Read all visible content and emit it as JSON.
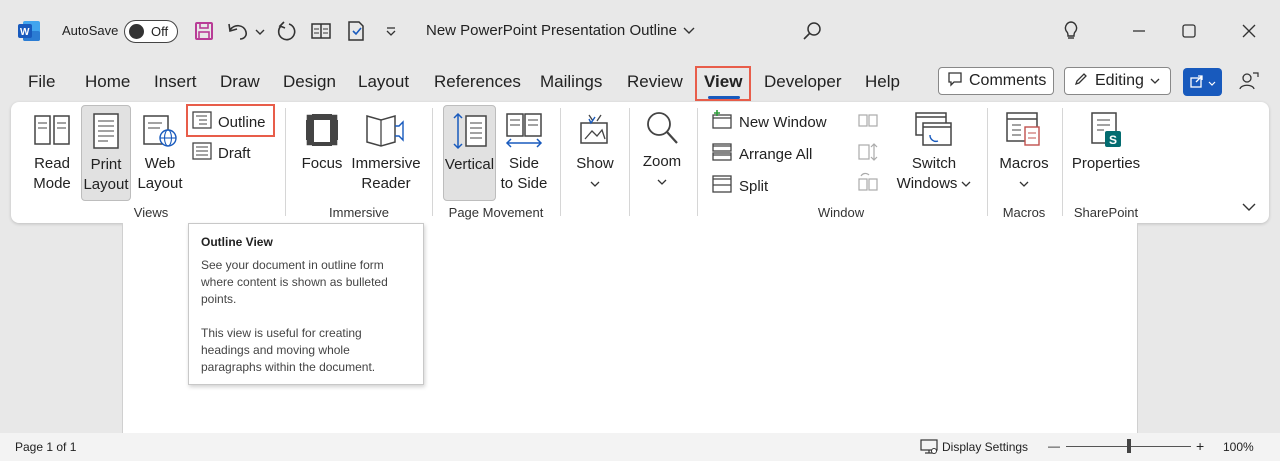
{
  "app": {
    "name": "Word"
  },
  "title_bar": {
    "autosave_label": "AutoSave",
    "autosave_state": "Off",
    "document_title": "New PowerPoint Presentation Outline",
    "icons": [
      "word-logo-icon",
      "save-icon",
      "undo-icon",
      "redo-icon",
      "table-icon",
      "document-check-icon",
      "customize-dropdown-icon",
      "search-icon",
      "lightbulb-icon",
      "minimize-icon",
      "maximize-icon",
      "close-icon"
    ]
  },
  "menu_tabs": [
    "File",
    "Home",
    "Insert",
    "Draw",
    "Design",
    "Layout",
    "References",
    "Mailings",
    "Review",
    "View",
    "Developer",
    "Help"
  ],
  "active_tab": "View",
  "header_buttons": {
    "comments": "Comments",
    "editing": "Editing"
  },
  "ribbon": {
    "views": {
      "label": "Views",
      "read_mode": [
        "Read",
        "Mode"
      ],
      "print_layout": [
        "Print",
        "Layout"
      ],
      "web_layout": [
        "Web",
        "Layout"
      ],
      "outline": "Outline",
      "draft": "Draft"
    },
    "immersive": {
      "label": "Immersive",
      "focus": "Focus",
      "immersive_reader": [
        "Immersive",
        "Reader"
      ]
    },
    "page_movement": {
      "label": "Page Movement",
      "vertical": "Vertical",
      "side_to_side": [
        "Side",
        "to Side"
      ]
    },
    "show": "Show",
    "zoom": "Zoom",
    "window": {
      "label": "Window",
      "new_window": "New Window",
      "arrange_all": "Arrange All",
      "split": "Split",
      "switch_windows": [
        "Switch",
        "Windows"
      ]
    },
    "macros": {
      "label": "Macros",
      "button": "Macros"
    },
    "sharepoint": {
      "label": "SharePoint",
      "properties": "Properties"
    }
  },
  "tooltip": {
    "title": "Outline View",
    "paragraph1": "See your document in outline form where content is shown as bulleted points.",
    "paragraph2": "This view is useful for creating headings and moving whole paragraphs within the document."
  },
  "status_bar": {
    "page": "Page 1 of 1",
    "display_settings": "Display Settings",
    "zoom_minus": "—",
    "zoom_plus": "+",
    "zoom": "100%",
    "zoom_slider_fraction": 0.5
  },
  "colors": {
    "accent": "#185abd",
    "highlight": "#e85d4a",
    "save_icon": "#b83c96",
    "word_blue": "#185abd"
  }
}
